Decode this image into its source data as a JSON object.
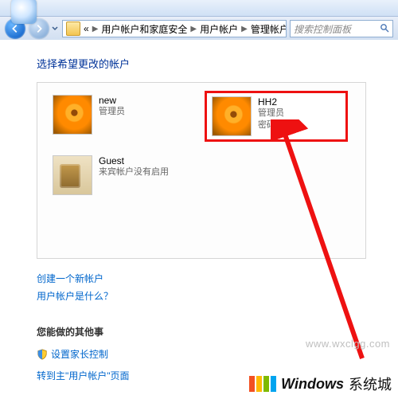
{
  "breadcrumb": {
    "items": [
      "用户帐户和家庭安全",
      "用户帐户",
      "管理帐户"
    ]
  },
  "search": {
    "placeholder": "搜索控制面板"
  },
  "page": {
    "heading": "选择希望更改的帐户",
    "accounts": [
      {
        "id": "new",
        "name": "new",
        "line1": "管理员",
        "line2": "",
        "pic": "flower"
      },
      {
        "id": "hh2",
        "name": "HH2",
        "line1": "管理员",
        "line2": "密码保护",
        "pic": "flower",
        "highlight": true
      },
      {
        "id": "guest",
        "name": "Guest",
        "line1": "来宾帐户没有启用",
        "line2": "",
        "pic": "guest"
      }
    ],
    "links": {
      "create": "创建一个新帐户",
      "whatis": "用户帐户是什么？"
    },
    "other_section": "您能做的其他事",
    "other_links": {
      "parental": "设置家长控制",
      "goto_main": "转到主\"用户帐户\"页面"
    }
  },
  "watermark": "www.wxclgg.com",
  "brand": {
    "text": "Windows",
    "suffix": "系统城"
  },
  "colors": {
    "flag": [
      "#f25022",
      "#ffb900",
      "#7fba00",
      "#00a4ef"
    ]
  }
}
